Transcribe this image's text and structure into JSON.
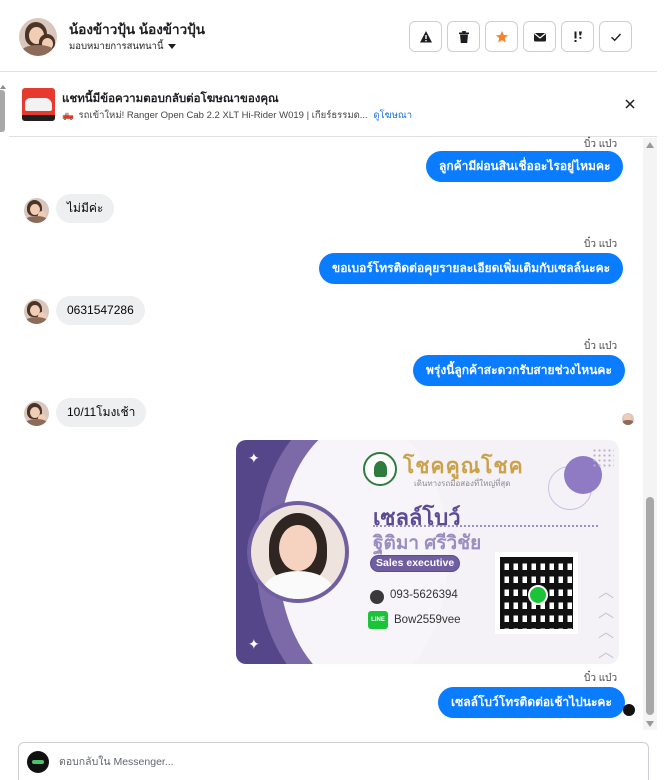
{
  "header": {
    "contact_name": "น้องข้าวปุ้น น้องข้าวปุ้น",
    "assign_label": "มอบหมายการสนทนานี้",
    "action_icons": [
      "warning-icon",
      "trash-icon",
      "star-icon",
      "mail-icon",
      "mark-important-icon",
      "check-icon"
    ],
    "star_color": "#f5832a"
  },
  "ad": {
    "title": "แชทนี้มีข้อความตอบกลับต่อโฆษณาของคุณ",
    "subtitle_emoji": "🛻",
    "subtitle": "รถเข้าใหม่! Ranger Open Cab 2.2 XLT Hi-Rider W019 | เกียร์ธรรมด...",
    "link": "ดูโฆษณา"
  },
  "messages": {
    "m1_sender": "บิ๋ว แบ๋ว",
    "m1_text": "ลูกค้ามีผ่อนสินเชื่ออะไรอยู่ไหมคะ",
    "m2_text": "ไม่มีค่ะ",
    "m3_sender": "บิ๋ว แบ๋ว",
    "m3_text": "ขอเบอร์โทรติดต่อคุยรายละเอียดเพิ่มเติมกับเซลล์นะคะ",
    "m4_text": "0631547286",
    "m5_sender": "บิ๋ว แบ๋ว",
    "m5_text": "พรุ่งนี้ลูกค้าสะดวกรับสายช่วงไหนคะ",
    "m6_text": "10/11โมงเช้า",
    "m8_sender": "บิ๋ว แบ๋ว",
    "m8_text": "เซลล์โบว์โทรติดต่อเช้าไปนะคะ"
  },
  "card": {
    "brand": "โชคคูณโชค",
    "tagline": "เดินทางรถมือสองที่ใหญ่ที่สุด",
    "nickname": "เซลล์โบว์",
    "fullname": "ฐิติมา ศรีวิชัย",
    "role": "Sales executive",
    "phone": "093-5626394",
    "line_label": "LINE",
    "line_id": "Bow2559vee",
    "accent": "#5b4a95"
  },
  "composer": {
    "placeholder": "ตอบกลับใน Messenger..."
  },
  "colors": {
    "outgoing_bubble": "#0a7cff",
    "incoming_bubble": "#eeeff1"
  }
}
